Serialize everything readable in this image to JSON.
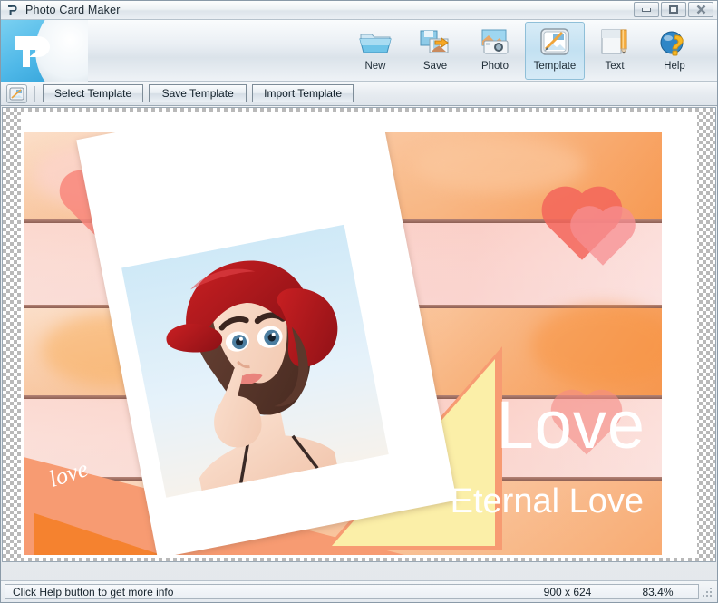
{
  "window": {
    "title": "Photo Card Maker",
    "logo_icon": "app-logo-p-icon",
    "controls": {
      "minimize": "minimize-icon",
      "maximize": "maximize-icon",
      "close": "close-icon"
    }
  },
  "toolbar": {
    "brand_icon": "brand-logo-p-icon",
    "items": [
      {
        "label": "New",
        "icon": "new-folder-icon",
        "selected": false
      },
      {
        "label": "Save",
        "icon": "save-disk-icon",
        "selected": false
      },
      {
        "label": "Photo",
        "icon": "photo-camera-icon",
        "selected": false
      },
      {
        "label": "Template",
        "icon": "template-icon",
        "selected": true
      },
      {
        "label": "Text",
        "icon": "text-pencil-icon",
        "selected": false
      },
      {
        "label": "Help",
        "icon": "help-globe-icon",
        "selected": false
      }
    ]
  },
  "subtoolbar": {
    "mode_icon": "template-mode-icon",
    "buttons": [
      {
        "label": "Select Template"
      },
      {
        "label": "Save Template"
      },
      {
        "label": "Import Template"
      }
    ]
  },
  "canvas": {
    "card": {
      "headline": "Love",
      "subheadline": "Eternal Love",
      "corner_text": "love",
      "photo_alt": "portrait-of-woman-in-red-hat"
    }
  },
  "statusbar": {
    "message": "Click Help button to get more info",
    "dimensions": "900 x 624",
    "zoom": "83.4%",
    "grip_icon": "resize-grip-icon"
  },
  "colors": {
    "accent": "#4fb8e8",
    "selected_tab": "#c3e1f2",
    "card_orange": "#f79b72",
    "card_yellow": "#fbefa8",
    "hat_red": "#b4161d"
  }
}
